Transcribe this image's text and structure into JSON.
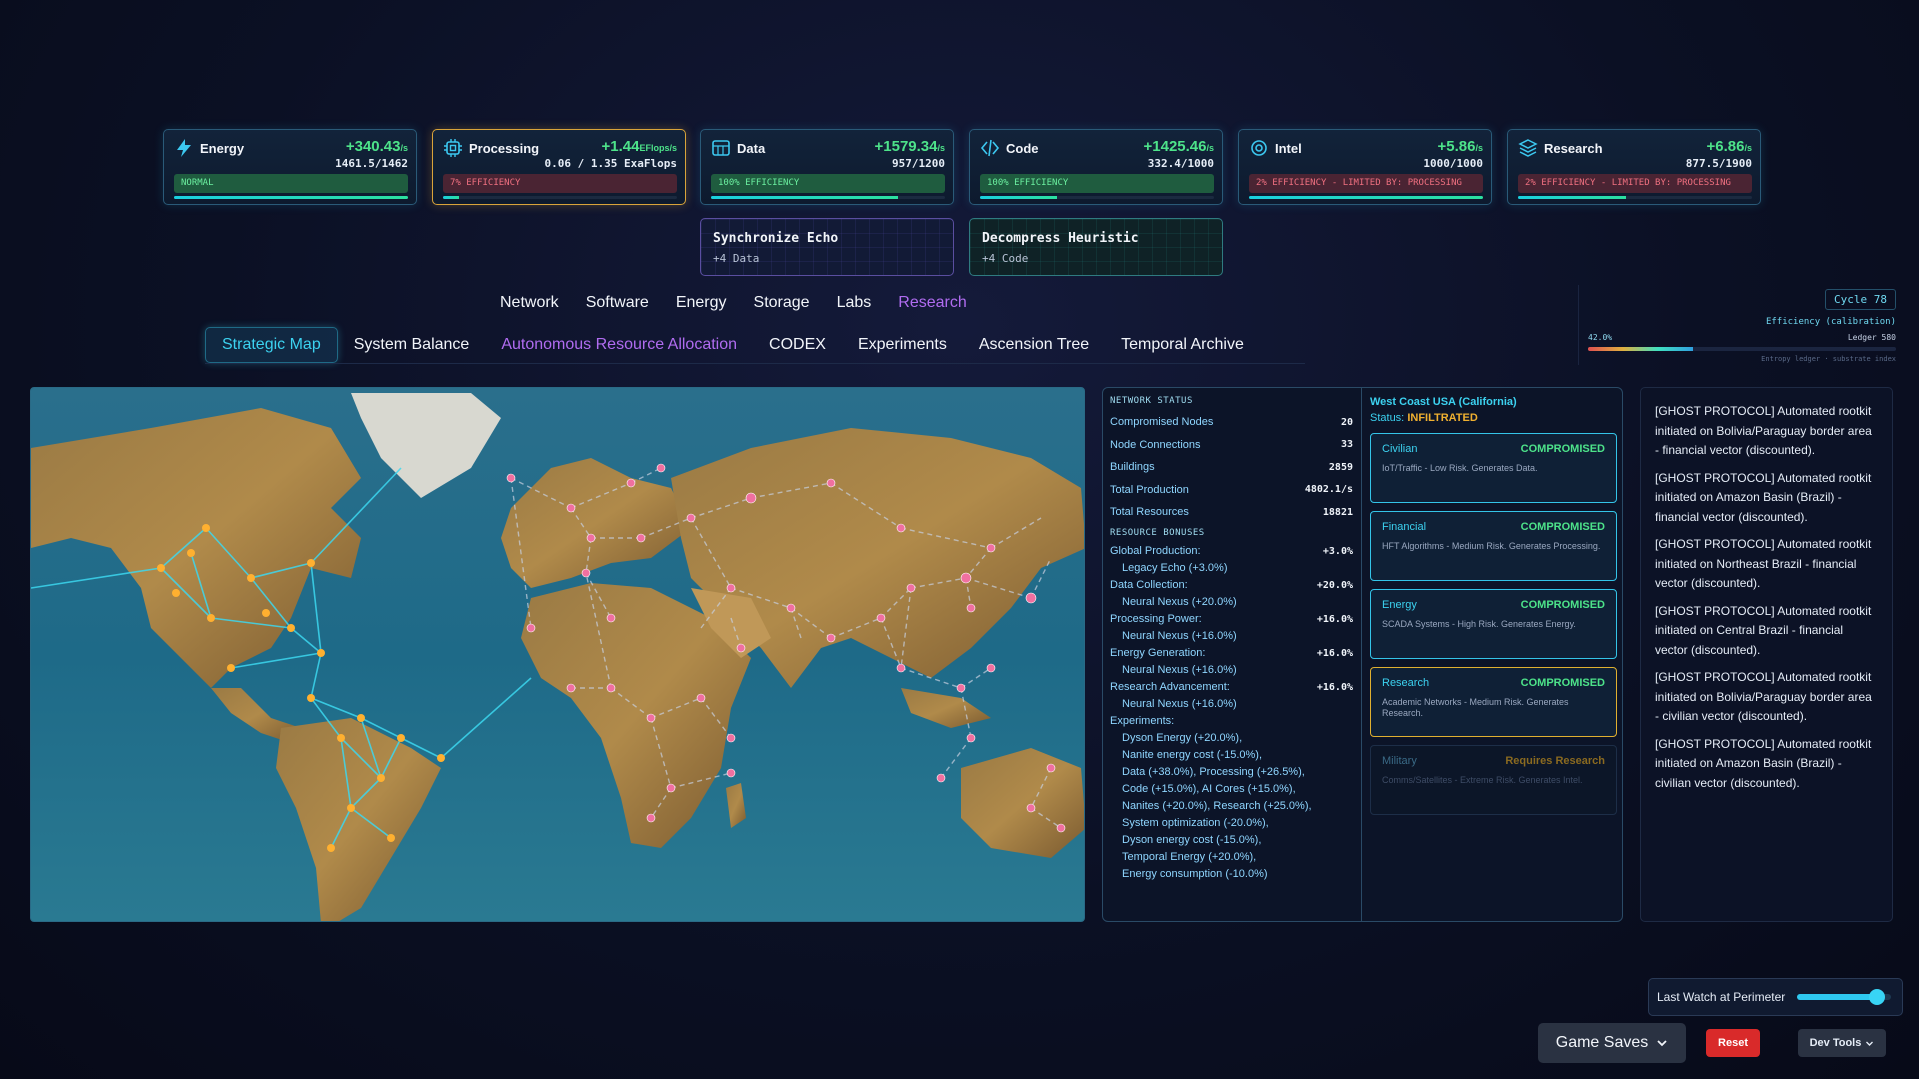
{
  "resources": [
    {
      "name": "Energy",
      "icon": "lightning-icon",
      "rate": "+340.43",
      "unit": "/s",
      "amount": "1461.5/1462",
      "status": "NORMAL",
      "status_type": "green",
      "bar": 0.999,
      "warn": false
    },
    {
      "name": "Processing",
      "icon": "chip-icon",
      "rate": "+1.44",
      "unit": "EFlops/s",
      "amount": "0.06 / 1.35 ExaFlops",
      "status": "7% EFFICIENCY",
      "status_type": "red",
      "bar": 0.07,
      "warn": true
    },
    {
      "name": "Data",
      "icon": "database-icon",
      "rate": "+1579.34",
      "unit": "/s",
      "amount": "957/1200",
      "status": "100% EFFICIENCY",
      "status_type": "green",
      "bar": 0.8,
      "warn": false
    },
    {
      "name": "Code",
      "icon": "code-icon",
      "rate": "+1425.46",
      "unit": "/s",
      "amount": "332.4/1000",
      "status": "100% EFFICIENCY",
      "status_type": "green",
      "bar": 0.33,
      "warn": false
    },
    {
      "name": "Intel",
      "icon": "target-icon",
      "rate": "+5.86",
      "unit": "/s",
      "amount": "1000/1000",
      "status": "2% EFFICIENCY - LIMITED BY: PROCESSING",
      "status_type": "red",
      "bar": 1.0,
      "warn": false
    },
    {
      "name": "Research",
      "icon": "layers-icon",
      "rate": "+6.86",
      "unit": "/s",
      "amount": "877.5/1900",
      "status": "2% EFFICIENCY - LIMITED BY: PROCESSING",
      "status_type": "red",
      "bar": 0.46,
      "warn": false
    }
  ],
  "actions": [
    {
      "title": "Synchronize Echo",
      "reward": "+4 Data"
    },
    {
      "title": "Decompress Heuristic",
      "reward": "+4 Code"
    }
  ],
  "nav_top": [
    "Network",
    "Software",
    "Energy",
    "Storage",
    "Labs",
    "Research"
  ],
  "nav_top_active": "Research",
  "nav_sub": [
    "Strategic Map",
    "System Balance",
    "Autonomous Resource Allocation",
    "CODEX",
    "Experiments",
    "Ascension Tree",
    "Temporal Archive"
  ],
  "nav_sub_active": "Strategic Map",
  "cycle": {
    "label": "Cycle 78",
    "efficiency_label": "Efficiency (calibration)",
    "pct": "42.0%",
    "value": 0.34,
    "ledger": "Ledger 580",
    "note": "Entropy ledger · substrate index"
  },
  "network_status": {
    "header": "NETWORK STATUS",
    "stats": [
      {
        "label": "Compromised Nodes",
        "value": "20"
      },
      {
        "label": "Node Connections",
        "value": "33"
      },
      {
        "label": "Buildings",
        "value": "2859"
      },
      {
        "label": "Total Production",
        "value": "4802.1/s"
      },
      {
        "label": "Total Resources",
        "value": "18821"
      }
    ],
    "bonus_header": "RESOURCE BONUSES",
    "bonuses": [
      {
        "label": "Global Production:",
        "value": "+3.0%",
        "source": "Legacy Echo (+3.0%)"
      },
      {
        "label": "Data Collection:",
        "value": "+20.0%",
        "source": "Neural Nexus (+20.0%)"
      },
      {
        "label": "Processing Power:",
        "value": "+16.0%",
        "source": "Neural Nexus (+16.0%)"
      },
      {
        "label": "Energy Generation:",
        "value": "+16.0%",
        "source": "Neural Nexus (+16.0%)"
      },
      {
        "label": "Research Advancement:",
        "value": "+16.0%",
        "source": "Neural Nexus (+16.0%)"
      }
    ],
    "experiments_label": "Experiments:",
    "experiments": [
      "Dyson Energy (+20.0%),",
      "Nanite energy cost (-15.0%),",
      "Data (+38.0%), Processing (+26.5%),",
      "Code (+15.0%), AI Cores (+15.0%),",
      "Nanites (+20.0%), Research (+25.0%),",
      "System optimization (-20.0%),",
      "Dyson energy cost (-15.0%),",
      "Temporal Energy (+20.0%),",
      "Energy consumption (-10.0%)"
    ]
  },
  "region": {
    "title": "West Coast USA (California)",
    "status_label": "Status:",
    "status": "INFILTRATED",
    "sectors": [
      {
        "name": "Civilian",
        "state": "COMPROMISED",
        "desc": "IoT/Traffic - Low Risk. Generates Data.",
        "style": "normal"
      },
      {
        "name": "Financial",
        "state": "COMPROMISED",
        "desc": "HFT Algorithms - Medium Risk. Generates Processing.",
        "style": "normal"
      },
      {
        "name": "Energy",
        "state": "COMPROMISED",
        "desc": "SCADA Systems - High Risk. Generates Energy.",
        "style": "normal"
      },
      {
        "name": "Research",
        "state": "COMPROMISED",
        "desc": "Academic Networks - Medium Risk. Generates Research.",
        "style": "gold"
      },
      {
        "name": "Military",
        "state": "Requires Research",
        "desc": "Comms/Satellites - Extreme Risk. Generates Intel.",
        "style": "locked"
      }
    ]
  },
  "log": [
    "[GHOST PROTOCOL] Automated rootkit initiated on Bolivia/Paraguay border area - financial vector (discounted).",
    "[GHOST PROTOCOL] Automated rootkit initiated on Amazon Basin (Brazil) - financial vector (discounted).",
    "[GHOST PROTOCOL] Automated rootkit initiated on Northeast Brazil - financial vector (discounted).",
    "[GHOST PROTOCOL] Automated rootkit initiated on Central Brazil - financial vector (discounted).",
    "[GHOST PROTOCOL] Automated rootkit initiated on Bolivia/Paraguay border area - civilian vector (discounted).",
    "[GHOST PROTOCOL] Automated rootkit initiated on Amazon Basin (Brazil) - civilian vector (discounted)."
  ],
  "perimeter": {
    "label": "Last Watch at Perimeter",
    "value": 0.85
  },
  "buttons": {
    "saves": "Game Saves",
    "reset": "Reset",
    "dev": "Dev Tools"
  },
  "colors": {
    "accent": "#3cd2f0",
    "active_research": "#b06cf0",
    "good": "#4de38a",
    "warn": "#f0b030",
    "danger": "#d92a2a"
  }
}
